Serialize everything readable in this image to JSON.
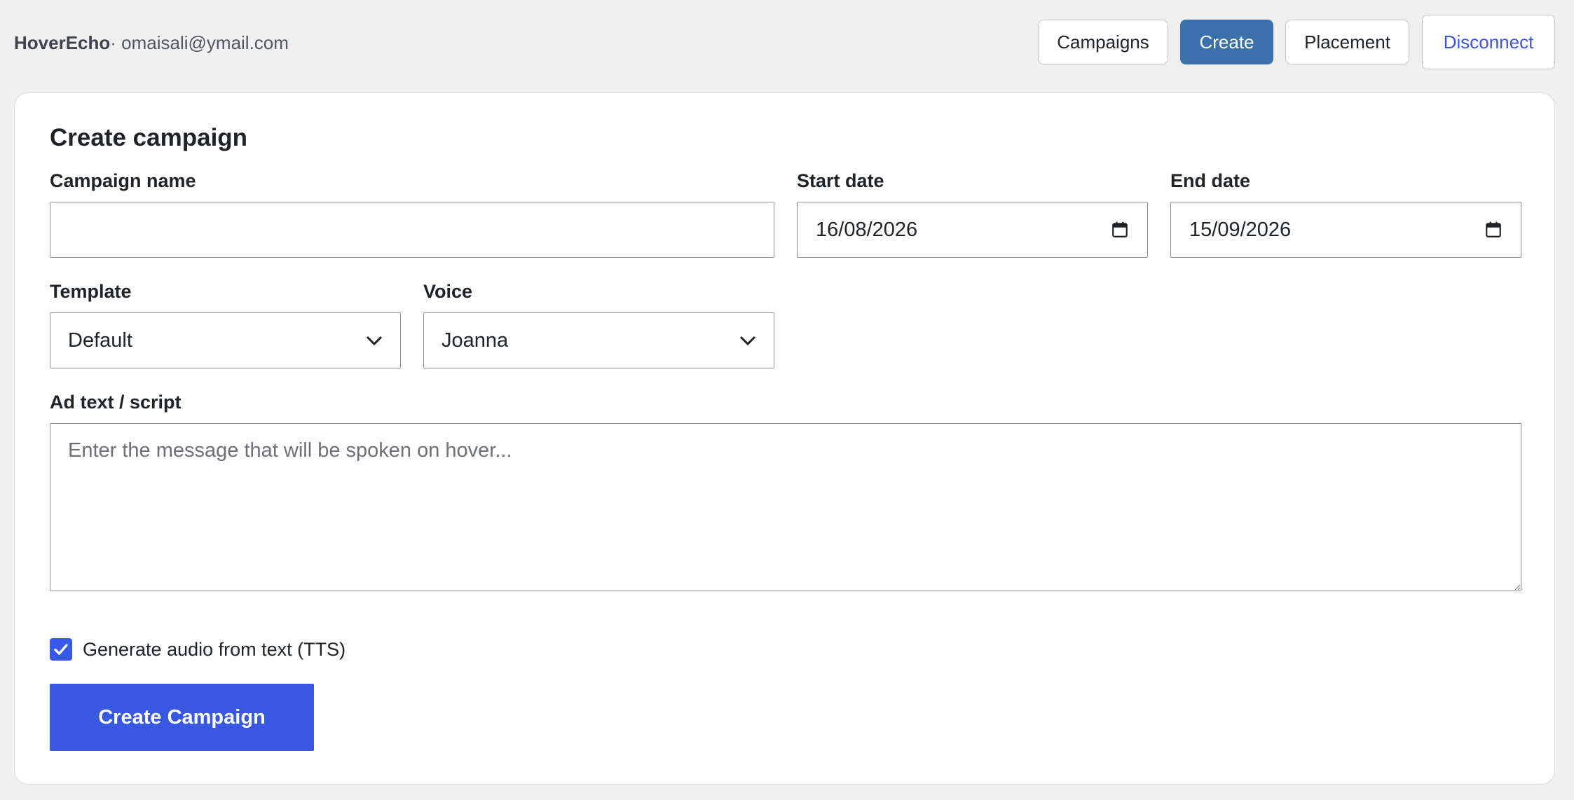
{
  "header": {
    "brand_name": "HoverEcho",
    "account": "· omaisali@ymail.com",
    "nav": {
      "campaigns": "Campaigns",
      "create": "Create",
      "placement": "Placement",
      "disconnect": "Disconnect"
    },
    "active_nav": "create"
  },
  "form": {
    "title": "Create campaign",
    "campaign_name": {
      "label": "Campaign name",
      "value": ""
    },
    "start_date": {
      "label": "Start date",
      "value": "16/08/2026"
    },
    "end_date": {
      "label": "End date",
      "value": "15/09/2026"
    },
    "template": {
      "label": "Template",
      "selected": "Default"
    },
    "voice": {
      "label": "Voice",
      "selected": "Joanna"
    },
    "ad_text": {
      "label": "Ad text / script",
      "value": "",
      "placeholder": "Enter the message that will be spoken on hover..."
    },
    "tts": {
      "label": "Generate audio from text (TTS)",
      "checked": true
    },
    "submit_label": "Create Campaign"
  },
  "colors": {
    "page_bg": "#f0f0f1",
    "active_nav": "#3a71aa",
    "primary": "#3858e1",
    "link": "#3d54d8"
  },
  "icons": {
    "date_picker": "calendar-icon",
    "select": "chevron-down-icon",
    "checkbox": "checkmark-icon"
  }
}
